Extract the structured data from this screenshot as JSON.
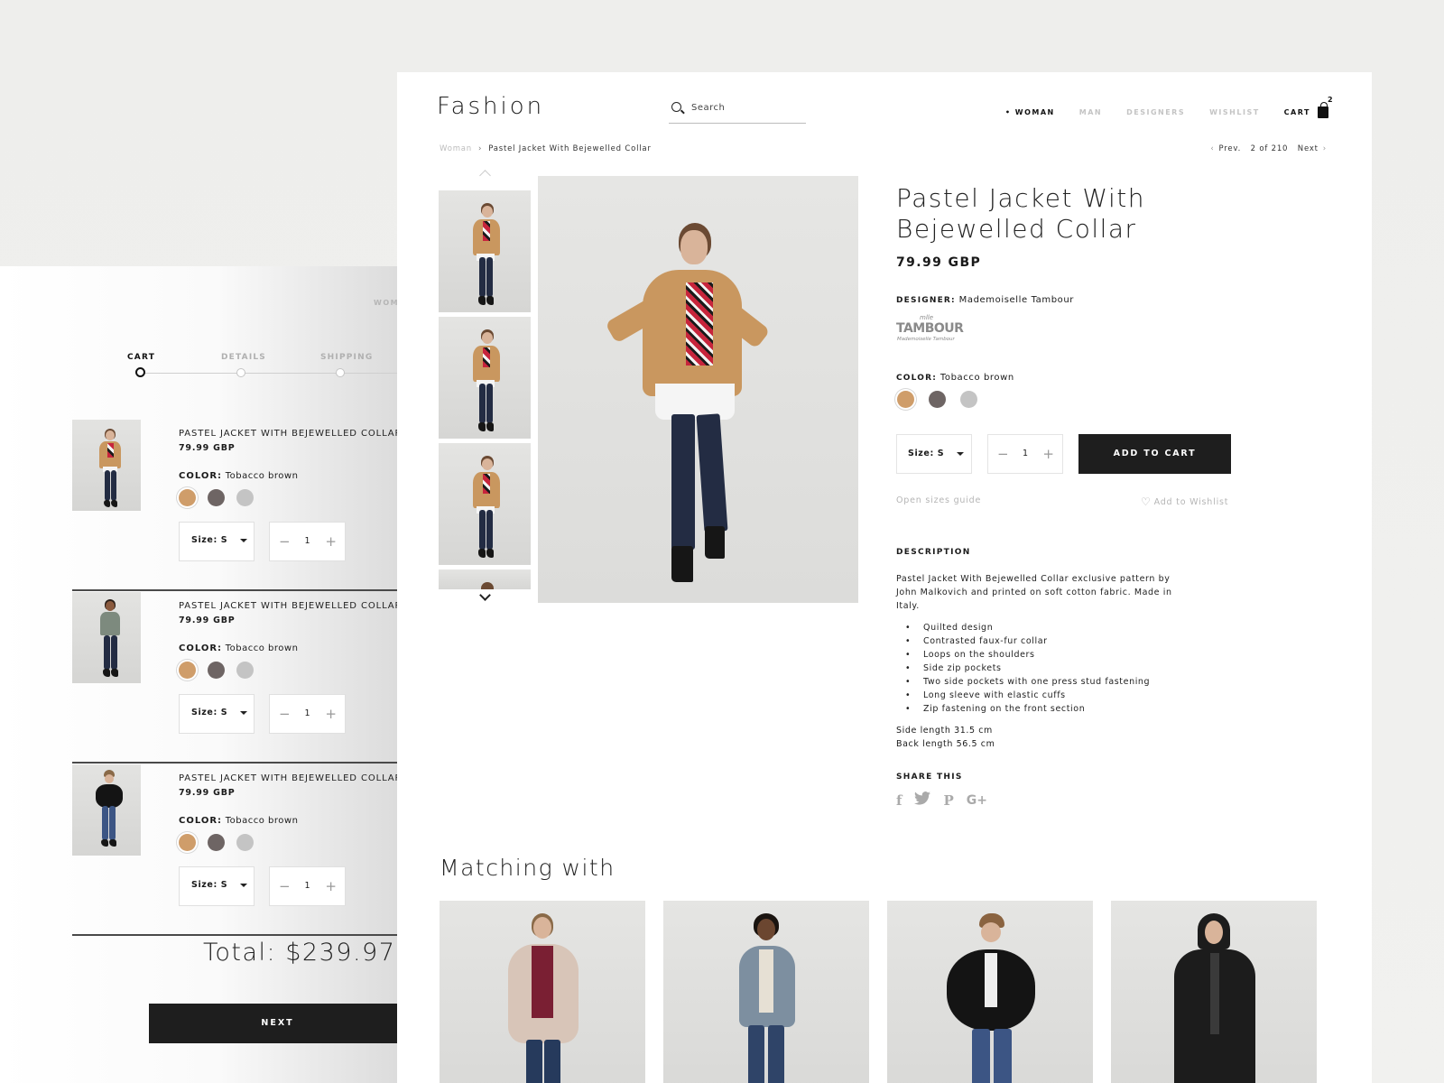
{
  "cart": {
    "topnav_label": "WOM",
    "steps": [
      {
        "label": "CART",
        "active": true
      },
      {
        "label": "DETAILS",
        "active": false
      },
      {
        "label": "SHIPPING",
        "active": false
      }
    ],
    "items": [
      {
        "name": "PASTEL JACKET WITH BEJEWELLED COLLAR",
        "price": "79.99 GBP",
        "color_label": "COLOR:",
        "color_value": "Tobacco brown",
        "size": "Size: S",
        "qty": "1",
        "coat_color": "#c9975f"
      },
      {
        "name": "PASTEL JACKET WITH BEJEWELLED COLLAR",
        "price": "79.99 GBP",
        "color_label": "COLOR:",
        "color_value": "Tobacco brown",
        "size": "Size: S",
        "qty": "1",
        "coat_color": "#7d8a7e"
      },
      {
        "name": "PASTEL JACKET WITH BEJEWELLED COLLAR",
        "price": "79.99 GBP",
        "color_label": "COLOR:",
        "color_value": "Tobacco brown",
        "size": "Size: S",
        "qty": "1",
        "coat_color": "#141414"
      }
    ],
    "swatches": [
      "#cf9d6a",
      "#6e6564",
      "#c4c4c4"
    ],
    "qty_minus": "−",
    "qty_plus": "+",
    "total": "Total: $239.97",
    "next_label": "NEXT"
  },
  "header": {
    "logo": "Fashion",
    "search_placeholder": "Search",
    "nav": [
      {
        "label": "• WOMAN",
        "active": true
      },
      {
        "label": "MAN",
        "active": false
      },
      {
        "label": "DESIGNERS",
        "active": false
      },
      {
        "label": "WISHLIST",
        "active": false
      }
    ],
    "cart_label": "CART",
    "cart_count": "2"
  },
  "breadcrumb": {
    "parent": "Woman",
    "separator": "›",
    "current": "Pastel Jacket With Bejewelled Collar"
  },
  "pager": {
    "prev": "Prev.",
    "position": "2 of 210",
    "next": "Next",
    "left_arrow": "‹",
    "right_arrow": "›"
  },
  "product": {
    "title": "Pastel Jacket With Bejewelled Collar",
    "price": "79.99 GBP",
    "designer_label": "DESIGNER:",
    "designer": "Mademoiselle Tambour",
    "brand_logo": {
      "small": "mlle",
      "big": "TAMBOUR",
      "sub": "Mademoiselle Tambour"
    },
    "color_label": "COLOR:",
    "color_value": "Tobacco brown",
    "swatches": [
      "#cf9d6a",
      "#6e6564",
      "#c4c4c4"
    ],
    "size": "Size: S",
    "qty": "1",
    "qty_minus": "−",
    "qty_plus": "+",
    "add_to_cart": "ADD TO CART",
    "sizes_guide": "Open sizes guide",
    "wishlist": "Add to Wishlist",
    "description_heading": "DESCRIPTION",
    "description": "Pastel Jacket With Bejewelled Collar exclusive pattern by John Malkovich and printed on soft cotton fabric. Made in Italy.",
    "features": [
      "Quilted design",
      "Contrasted faux-fur collar",
      "Loops on the shoulders",
      "Side zip pockets",
      "Two side pockets with one press stud fastening",
      "Long sleeve with elastic cuffs",
      "Zip fastening on the front section"
    ],
    "side_length": "Side length 31.5 cm",
    "back_length": "Back length 56.5 cm",
    "share_heading": "SHARE THIS",
    "share_icons": [
      "facebook-icon",
      "twitter-icon",
      "pinterest-icon",
      "google-plus-icon"
    ]
  },
  "matching": {
    "title": "Matching with",
    "items": [
      {
        "coat_color": "#d8c5b8"
      },
      {
        "coat_color": "#7d8fa0"
      },
      {
        "coat_color": "#141414"
      },
      {
        "coat_color": "#1c1c1c"
      }
    ]
  }
}
